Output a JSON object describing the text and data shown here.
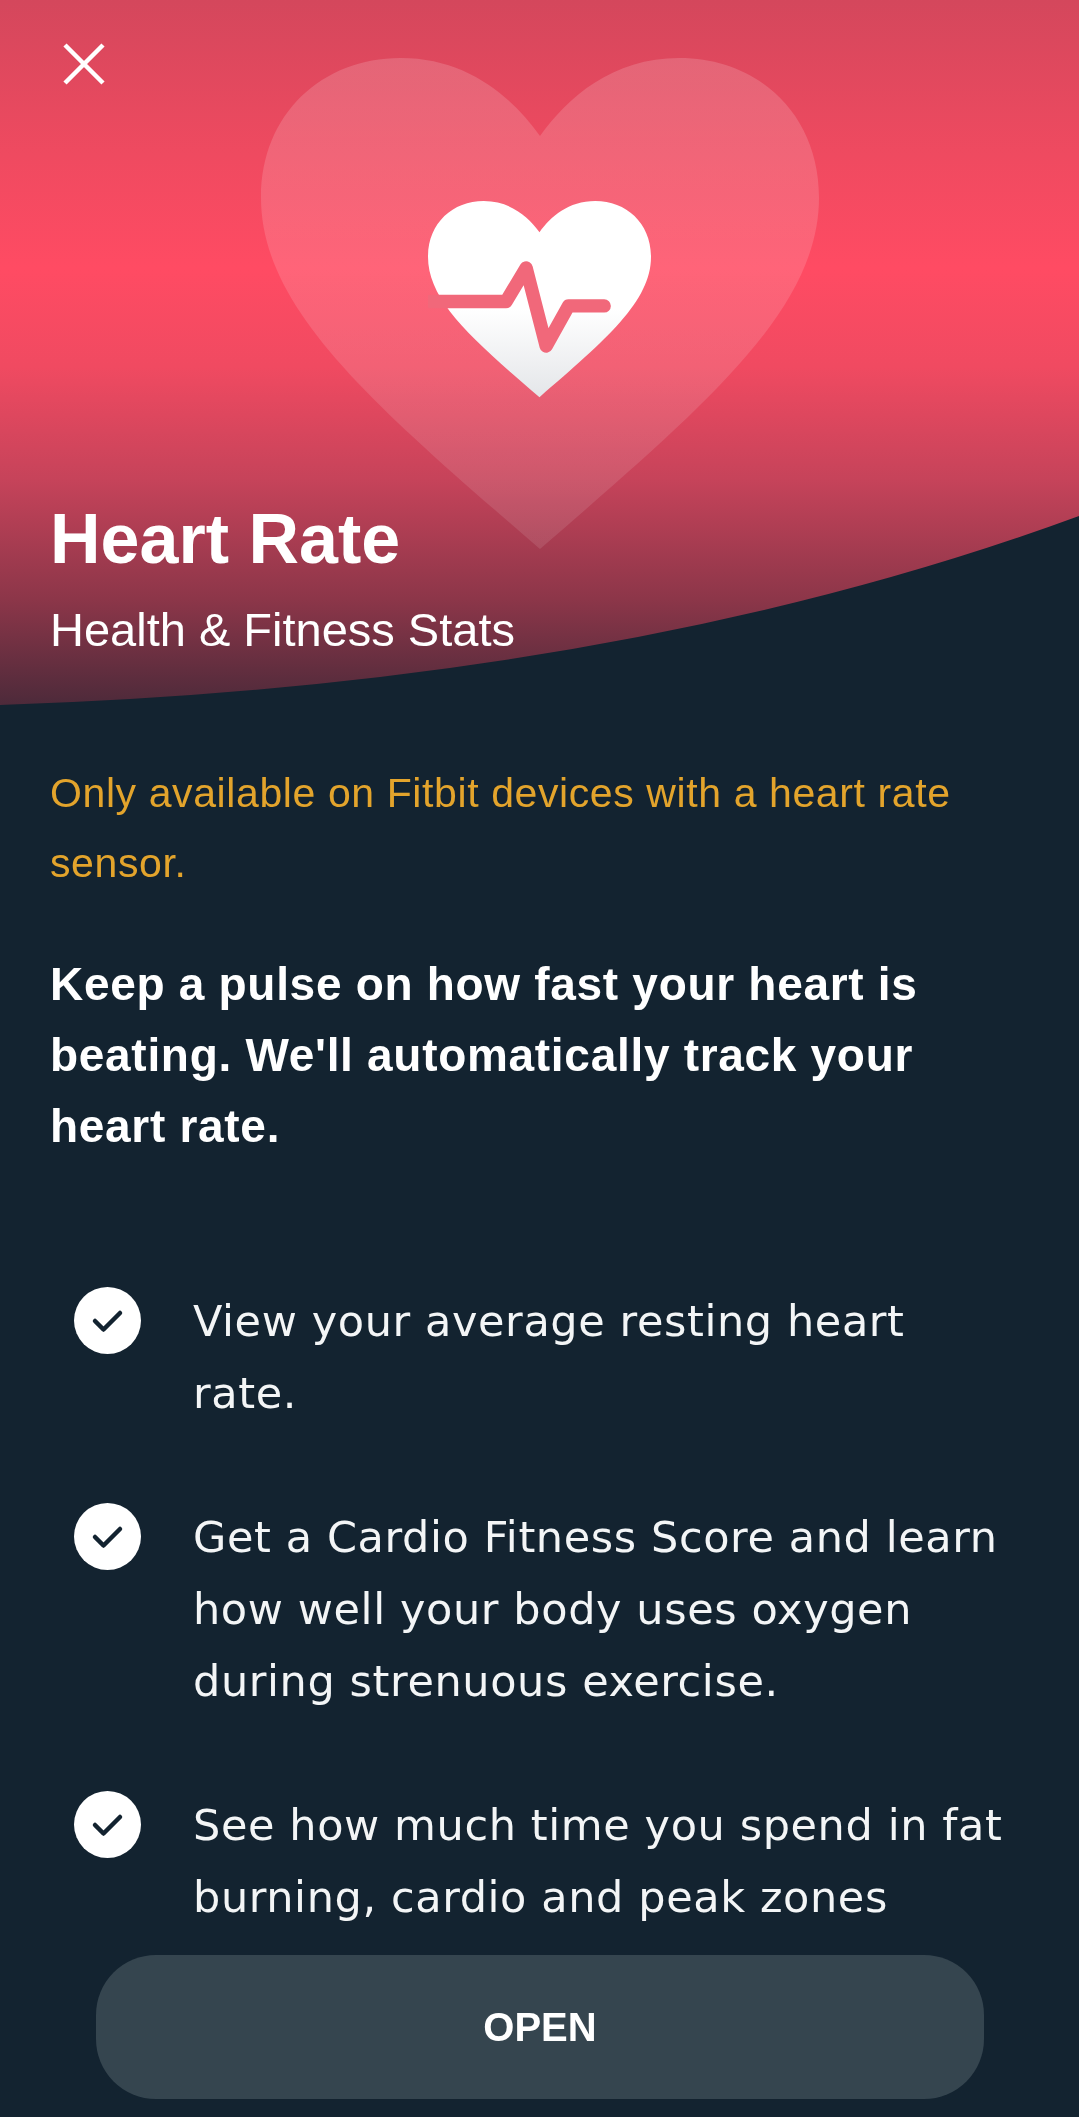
{
  "header": {
    "title": "Heart Rate",
    "subtitle": "Health & Fitness Stats"
  },
  "notice": "Only available on Fitbit devices with a heart rate sensor.",
  "description": "Keep a pulse on how fast your heart is beating. We'll automatically track your heart rate.",
  "features": [
    {
      "text": "View your average resting heart rate."
    },
    {
      "text": "Get a Cardio Fitness Score and learn how well your body uses oxygen during strenuous exercise."
    },
    {
      "text": "See how much time you spend in fat burning, cardio and peak zones"
    }
  ],
  "button": {
    "label": "OPEN"
  }
}
